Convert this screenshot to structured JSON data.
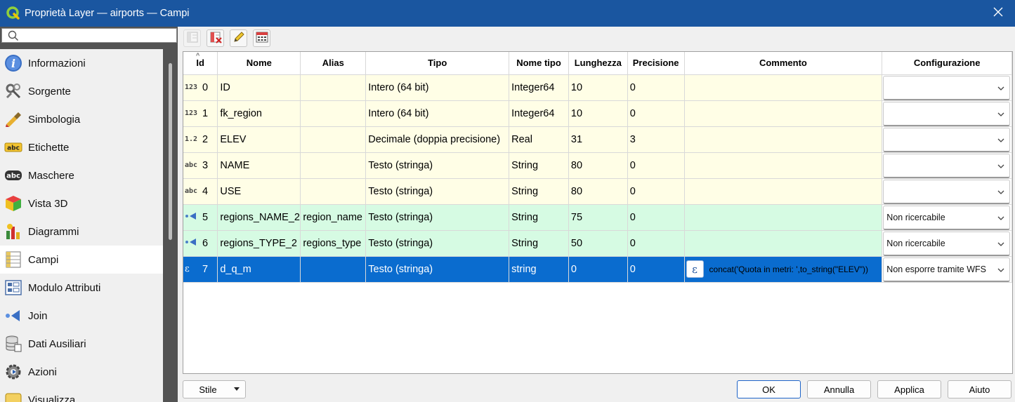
{
  "window": {
    "title": "Proprietà Layer — airports — Campi"
  },
  "sidebar": {
    "search_placeholder": "",
    "items": [
      {
        "label": "Informazioni",
        "icon": "info-icon"
      },
      {
        "label": "Sorgente",
        "icon": "source-icon"
      },
      {
        "label": "Simbologia",
        "icon": "symbology-icon"
      },
      {
        "label": "Etichette",
        "icon": "labels-icon"
      },
      {
        "label": "Maschere",
        "icon": "masks-icon"
      },
      {
        "label": "Vista 3D",
        "icon": "3d-view-icon"
      },
      {
        "label": "Diagrammi",
        "icon": "diagrams-icon"
      },
      {
        "label": "Campi",
        "icon": "fields-icon",
        "active": true
      },
      {
        "label": "Modulo Attributi",
        "icon": "attributes-form-icon"
      },
      {
        "label": "Join",
        "icon": "join-icon"
      },
      {
        "label": "Dati Ausiliari",
        "icon": "auxiliary-data-icon"
      },
      {
        "label": "Azioni",
        "icon": "actions-icon"
      },
      {
        "label": "Visualizza",
        "icon": "display-icon"
      }
    ]
  },
  "toolbar": {
    "buttons": [
      "new-field-icon",
      "delete-field-icon",
      "edit-mode-icon",
      "field-calculator-icon"
    ]
  },
  "table": {
    "headers": [
      "Id",
      "Nome",
      "Alias",
      "Tipo",
      "Nome tipo",
      "Lunghezza",
      "Precisione",
      "Commento",
      "Configurazione"
    ],
    "rows": [
      {
        "type_icon": "123",
        "id": "0",
        "name": "ID",
        "alias": "",
        "type": "Intero (64 bit)",
        "type_name": "Integer64",
        "length": "10",
        "precision": "0",
        "comment": "",
        "config": "",
        "style": "yellow"
      },
      {
        "type_icon": "123",
        "id": "1",
        "name": "fk_region",
        "alias": "",
        "type": "Intero (64 bit)",
        "type_name": "Integer64",
        "length": "10",
        "precision": "0",
        "comment": "",
        "config": "",
        "style": "yellow"
      },
      {
        "type_icon": "1.2",
        "id": "2",
        "name": "ELEV",
        "alias": "",
        "type": "Decimale (doppia precisione)",
        "type_name": "Real",
        "length": "31",
        "precision": "3",
        "comment": "",
        "config": "",
        "style": "yellow"
      },
      {
        "type_icon": "abc",
        "id": "3",
        "name": "NAME",
        "alias": "",
        "type": "Testo (stringa)",
        "type_name": "String",
        "length": "80",
        "precision": "0",
        "comment": "",
        "config": "",
        "style": "yellow"
      },
      {
        "type_icon": "abc",
        "id": "4",
        "name": "USE",
        "alias": "",
        "type": "Testo (stringa)",
        "type_name": "String",
        "length": "80",
        "precision": "0",
        "comment": "",
        "config": "",
        "style": "yellow"
      },
      {
        "type_icon": "join",
        "id": "5",
        "name": "regions_NAME_2",
        "alias": "region_name",
        "type": "Testo (stringa)",
        "type_name": "String",
        "length": "75",
        "precision": "0",
        "comment": "",
        "config": "Non ricercabile",
        "style": "green"
      },
      {
        "type_icon": "join",
        "id": "6",
        "name": "regions_TYPE_2",
        "alias": "regions_type",
        "type": "Testo (stringa)",
        "type_name": "String",
        "length": "50",
        "precision": "0",
        "comment": "",
        "config": "Non ricercabile",
        "style": "green"
      },
      {
        "type_icon": "expr",
        "id": "7",
        "name": "d_q_m",
        "alias": "",
        "type": "Testo (stringa)",
        "type_name": "string",
        "length": "0",
        "precision": "0",
        "comment": "concat('Quota in metri: ',to_string(\"ELEV\"))",
        "config": "Non esporre tramite WFS",
        "style": "selected"
      }
    ]
  },
  "buttons": {
    "style": "Stile",
    "ok": "OK",
    "cancel": "Annulla",
    "apply": "Applica",
    "help": "Aiuto"
  },
  "colors": {
    "titlebar": "#1a56a0",
    "selection": "#0a6ccf",
    "row_yellow": "#fffee6",
    "row_green": "#d6fbe3"
  }
}
